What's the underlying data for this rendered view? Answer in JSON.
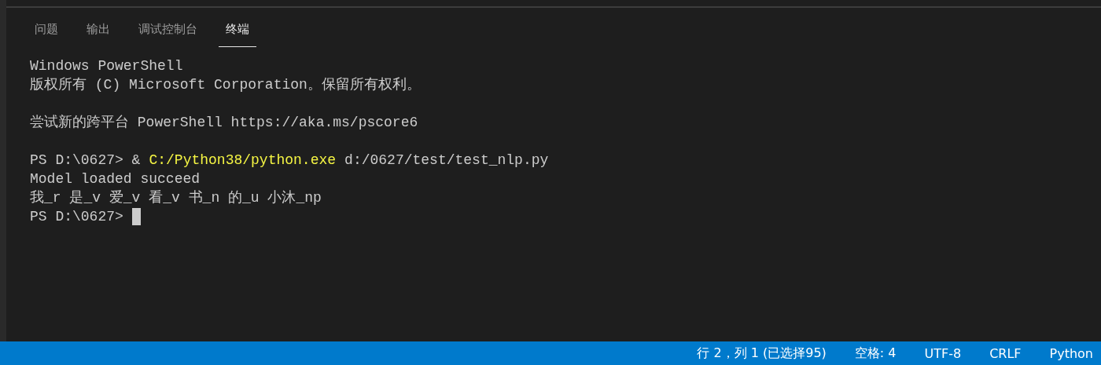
{
  "tabs": [
    {
      "label": "问题",
      "selected": false
    },
    {
      "label": "输出",
      "selected": false
    },
    {
      "label": "调试控制台",
      "selected": false
    },
    {
      "label": "终端",
      "selected": true
    }
  ],
  "terminal": {
    "blocks": [
      {
        "lines": [
          {
            "cursor": false,
            "segments": [
              {
                "text": "Windows PowerShell",
                "kind": "plain"
              }
            ]
          },
          {
            "cursor": false,
            "segments": [
              {
                "text": "版权所有 (C) Microsoft Corporation。保留所有权利。",
                "kind": "plain"
              }
            ]
          }
        ]
      },
      {
        "lines": [
          {
            "cursor": false,
            "segments": [
              {
                "text": "尝试新的跨平台 PowerShell https://aka.ms/pscore6",
                "kind": "plain"
              }
            ]
          }
        ]
      },
      {
        "lines": [
          {
            "cursor": false,
            "segments": [
              {
                "text": "PS D:\\0627> &",
                "kind": "plain"
              },
              {
                "text": "C:/Python38/python.exe",
                "kind": "highlight"
              },
              {
                "text": "d:/0627/test/test_nlp.py",
                "kind": "plain"
              }
            ]
          },
          {
            "cursor": false,
            "segments": [
              {
                "text": "Model loaded succeed",
                "kind": "plain"
              }
            ]
          },
          {
            "cursor": false,
            "segments": [
              {
                "text": "我_r 是_v 爱_v 看_v 书_n 的_u 小沐_np",
                "kind": "plain"
              }
            ]
          },
          {
            "cursor": true,
            "segments": [
              {
                "text": "PS D:\\0627>",
                "kind": "plain"
              }
            ]
          }
        ]
      }
    ]
  },
  "status_bar": {
    "items": [
      "行 2，列 1 (已选择95)",
      "空格: 4",
      "UTF-8",
      "CRLF",
      "Python"
    ]
  }
}
